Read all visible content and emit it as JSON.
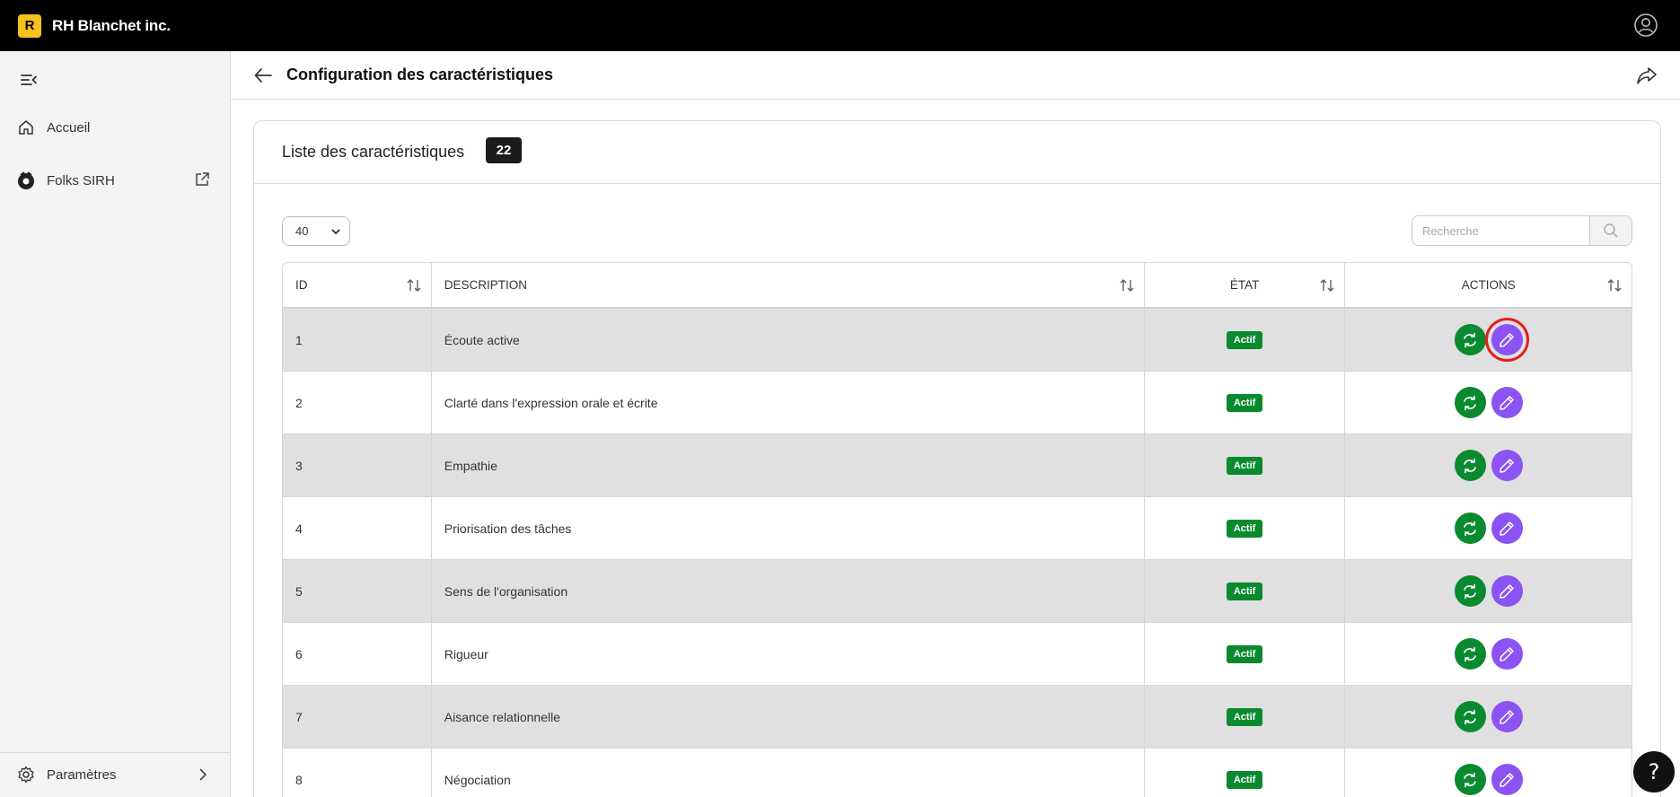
{
  "app": {
    "logo_letter": "R",
    "brand": "RH Blanchet inc."
  },
  "sidebar": {
    "items": [
      {
        "label": "Accueil",
        "icon": "home-icon"
      },
      {
        "label": "Folks SIRH",
        "icon": "folks-icon"
      }
    ],
    "footer": {
      "label": "Paramètres",
      "icon": "gear-icon"
    }
  },
  "header": {
    "title": "Configuration des caractéristiques"
  },
  "card": {
    "title": "Liste des caractéristiques",
    "count": "22",
    "per_page": "40",
    "search_placeholder": "Recherche"
  },
  "table": {
    "columns": [
      "ID",
      "DESCRIPTION",
      "ÉTAT",
      "ACTIONS"
    ],
    "rows": [
      {
        "id": "1",
        "description": "Écoute active",
        "state": "Actif"
      },
      {
        "id": "2",
        "description": "Clarté dans l'expression orale et écrite",
        "state": "Actif"
      },
      {
        "id": "3",
        "description": "Empathie",
        "state": "Actif"
      },
      {
        "id": "4",
        "description": "Priorisation des tâches",
        "state": "Actif"
      },
      {
        "id": "5",
        "description": "Sens de l'organisation",
        "state": "Actif"
      },
      {
        "id": "6",
        "description": "Rigueur",
        "state": "Actif"
      },
      {
        "id": "7",
        "description": "Aisance relationnelle",
        "state": "Actif"
      },
      {
        "id": "8",
        "description": "Négociation",
        "state": "Actif"
      }
    ]
  },
  "help": {
    "label": "?"
  },
  "colors": {
    "active_green": "#0a8a2f",
    "edit_purple": "#8b53f2",
    "highlight_red": "#e02020",
    "brand_yellow": "#f6c01d"
  }
}
